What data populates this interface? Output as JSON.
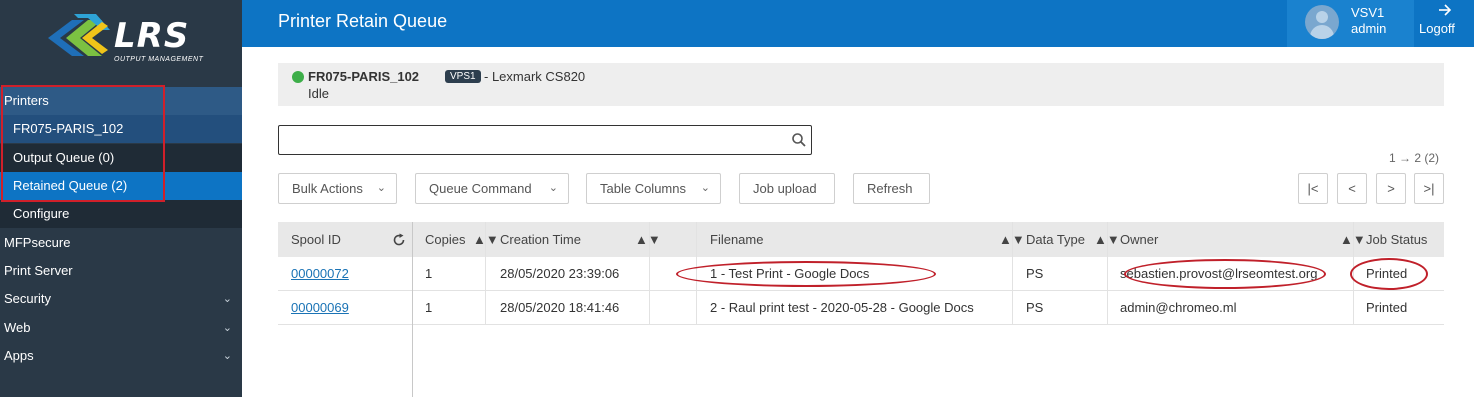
{
  "sidebar": {
    "logo_text": "LRS",
    "logo_subtitle": "OUTPUT MANAGEMENT",
    "items": [
      {
        "label": "Printers"
      },
      {
        "label": "FR075-PARIS_102"
      },
      {
        "label": "Output Queue (0)"
      },
      {
        "label": "Retained Queue (2)"
      },
      {
        "label": "Configure"
      },
      {
        "label": "MFPsecure"
      },
      {
        "label": "Print Server"
      },
      {
        "label": "Security",
        "icon": "chevron-down-icon"
      },
      {
        "label": "Web",
        "icon": "chevron-down-icon"
      },
      {
        "label": "Apps",
        "icon": "chevron-down-icon"
      }
    ]
  },
  "header": {
    "title": "Printer Retain Queue",
    "user_name": "VSV1",
    "user_role": "admin",
    "logoff_label": "Logoff",
    "logoff_icon": "arrow-right-icon"
  },
  "printer": {
    "name": "FR075-PARIS_102",
    "badge": "VPS1",
    "model": "- Lexmark CS820",
    "state": "Idle",
    "status_color": "#3dae49"
  },
  "search": {
    "value": "",
    "placeholder": ""
  },
  "pagination": {
    "info": "1 → 2 (2)",
    "first": "|<",
    "prev": "<",
    "next": ">",
    "last": ">|"
  },
  "toolbar": {
    "bulk_actions": "Bulk Actions",
    "queue_command": "Queue Command",
    "table_columns": "Table Columns",
    "job_upload": "Job upload",
    "refresh": "Refresh"
  },
  "table": {
    "columns": [
      "Spool ID",
      "Copies",
      "Creation Time",
      "Filename",
      "Data Type",
      "Owner",
      "Job Status"
    ],
    "rows": [
      {
        "spool_id": "00000072",
        "copies": "1",
        "creation_time": "28/05/2020 23:39:06",
        "filename": "1 - Test Print - Google Docs",
        "data_type": "PS",
        "owner": "sebastien.provost@lrseomtest.org",
        "status": "Printed"
      },
      {
        "spool_id": "00000069",
        "copies": "1",
        "creation_time": "28/05/2020 18:41:46",
        "filename": "2 - Raul print test - 2020-05-28 - Google Docs",
        "data_type": "PS",
        "owner": "admin@chromeo.ml",
        "status": "Printed"
      }
    ]
  },
  "colors": {
    "sidebar_bg": "#2a3947",
    "header_bg": "#0d74c4",
    "selected_item": "#0d74c4",
    "annotation_red": "#c0202a"
  }
}
